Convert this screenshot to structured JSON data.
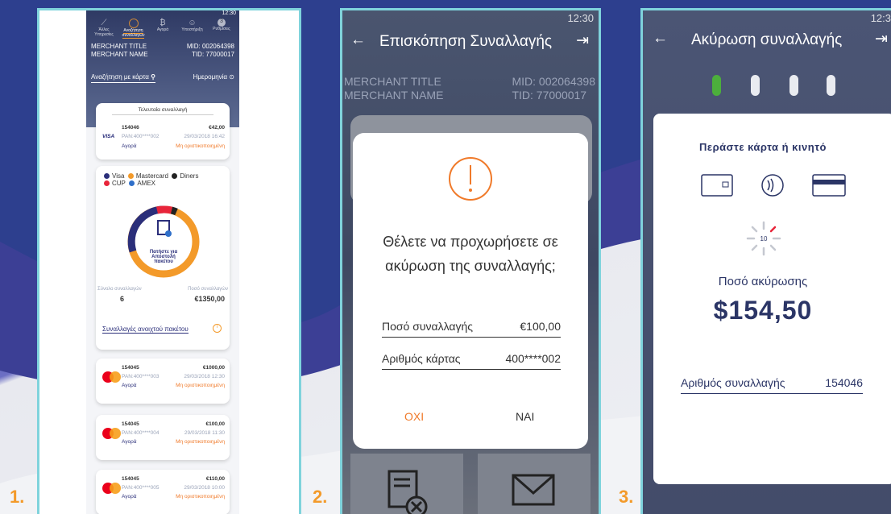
{
  "steps": {
    "s1": "1.",
    "s2": "2.",
    "s3": "3."
  },
  "phone1": {
    "status_time": "12:30",
    "nav": {
      "n1": "Άλλες Υπηρεσίες",
      "n2": "Αναζήτηση συναλλαγών",
      "n3": "Αγορά",
      "n4": "Υποστήριξη",
      "n5": "Ρυθμίσεις",
      "badge": "3"
    },
    "merchant_title": "MERCHANT TITLE",
    "merchant_name": "MERCHANT NAME",
    "mid": "MID: 002064398",
    "tid": "TID: 77000017",
    "search_label": "Αναζήτηση με κάρτα",
    "date_label": "Ημερομηνία",
    "last_tx": {
      "header": "Τελευταία συναλλαγή",
      "id": "154046",
      "amount": "€42,00",
      "brand": "VISA",
      "pan": "PAN:400****002",
      "date": "29/03/2018 16:42",
      "type": "Αγορά",
      "status": "Μη οριστικοποιημένη"
    },
    "legend": {
      "visa": "Visa",
      "mastercard": "Mastercard",
      "diners": "Diners",
      "cup": "CUP",
      "amex": "AMEX"
    },
    "colors": {
      "visa": "#2b2f7a",
      "mastercard": "#f39a2a",
      "diners": "#222222",
      "cup": "#e8253a",
      "amex": "#2f6fc9"
    },
    "donut_label": "Πατήστε για Αποστολή πακέτου",
    "total_count_label": "Σύνολο συναλλαγών",
    "total_count": "6",
    "total_amount_label": "Ποσό συναλλαγών",
    "total_amount": "€1350,00",
    "open_batch": "Συναλλαγές ανοιχτού πακέτου",
    "items": [
      {
        "id": "154045",
        "amount": "€1000,00",
        "pan": "PAN:400****003",
        "date": "29/03/2018 12:30",
        "type": "Αγορά",
        "status": "Μη οριστικοποιημένη"
      },
      {
        "id": "154045",
        "amount": "€100,00",
        "pan": "PAN:400****004",
        "date": "29/03/2018 11:30",
        "type": "Αγορά",
        "status": "Μη οριστικοποιημένη"
      },
      {
        "id": "154045",
        "amount": "€110,00",
        "pan": "PAN:400****005",
        "date": "29/03/2018 10:00",
        "type": "Αγορά",
        "status": "Μη οριστικοποιημένη"
      }
    ]
  },
  "phone2": {
    "status_time": "12:30",
    "title": "Επισκόπηση Συναλλαγής",
    "merchant_title": "MERCHANT TITLE",
    "merchant_name": "MERCHANT NAME",
    "mid": "MID: 002064398",
    "tid": "TID: 77000017",
    "question": "Θέλετε να προχωρήσετε σε ακύρωση της συναλλαγής;",
    "amount_label": "Ποσό συναλλαγής",
    "amount": "€100,00",
    "card_label": "Αριθμός κάρτας",
    "card": "400****002",
    "no": "ΟΧΙ",
    "yes": "ΝΑΙ"
  },
  "phone3": {
    "status_time": "12:3",
    "title": "Ακύρωση συναλλαγής",
    "prompt": "Περάστε κάρτα ή κινητό",
    "countdown": "10",
    "amount_label": "Ποσό ακύρωσης",
    "amount": "$154,50",
    "tx_label": "Αριθμός συναλλαγής",
    "tx": "154046"
  }
}
